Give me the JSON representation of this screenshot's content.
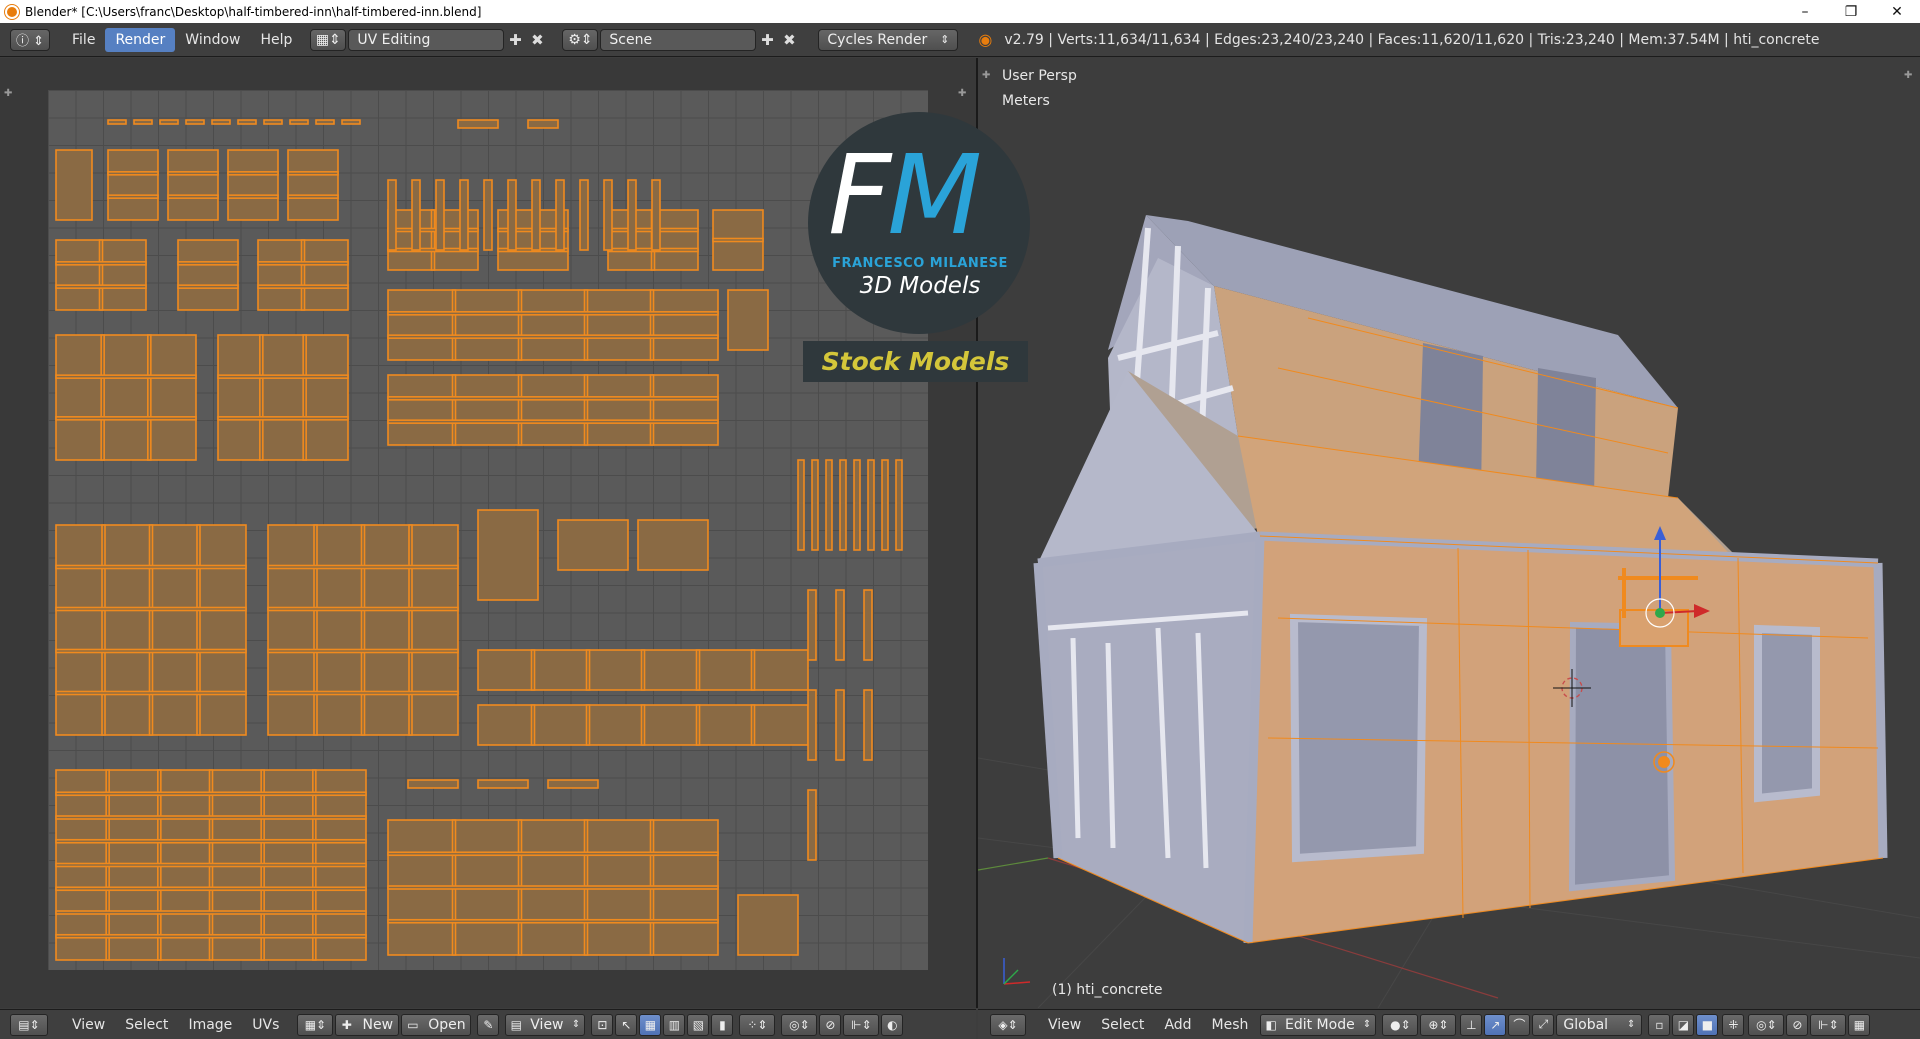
{
  "window": {
    "title": "Blender* [C:\\Users\\franc\\Desktop\\half-timbered-inn\\half-timbered-inn.blend]",
    "controls": {
      "minimize": "–",
      "restore": "❐",
      "close": "✕"
    }
  },
  "info_header": {
    "menus": [
      "File",
      "Render",
      "Window",
      "Help"
    ],
    "active_menu": "Render",
    "screen_layout": "UV Editing",
    "scene": "Scene",
    "render_engine": "Cycles Render",
    "stats": "v2.79 | Verts:11,634/11,634 | Edges:23,240/23,240 | Faces:11,620/11,620 | Tris:23,240 | Mem:37.54M | hti_concrete"
  },
  "viewport": {
    "view_name": "User Persp",
    "units": "Meters",
    "active_object": "(1) hti_concrete"
  },
  "logo": {
    "letters_f": "F",
    "letters_m": "M",
    "name": "FRANCESCO MILANESE",
    "subtitle": "3D Models",
    "banner": "Stock Models"
  },
  "uv_header": {
    "menus": [
      "View",
      "Select",
      "Image",
      "UVs"
    ],
    "new_label": "New",
    "open_label": "Open",
    "view_label": "View"
  },
  "view3d_header": {
    "menus": [
      "View",
      "Select",
      "Add",
      "Mesh"
    ],
    "mode": "Edit Mode",
    "orientation": "Global"
  },
  "colors": {
    "accent": "#5680c2",
    "uv_fill": "#8a6a44",
    "uv_edge": "#f08a1e",
    "mesh": "#9fa3b8",
    "logo_blue": "#2aa3d8",
    "logo_yellow": "#d4c63a"
  }
}
